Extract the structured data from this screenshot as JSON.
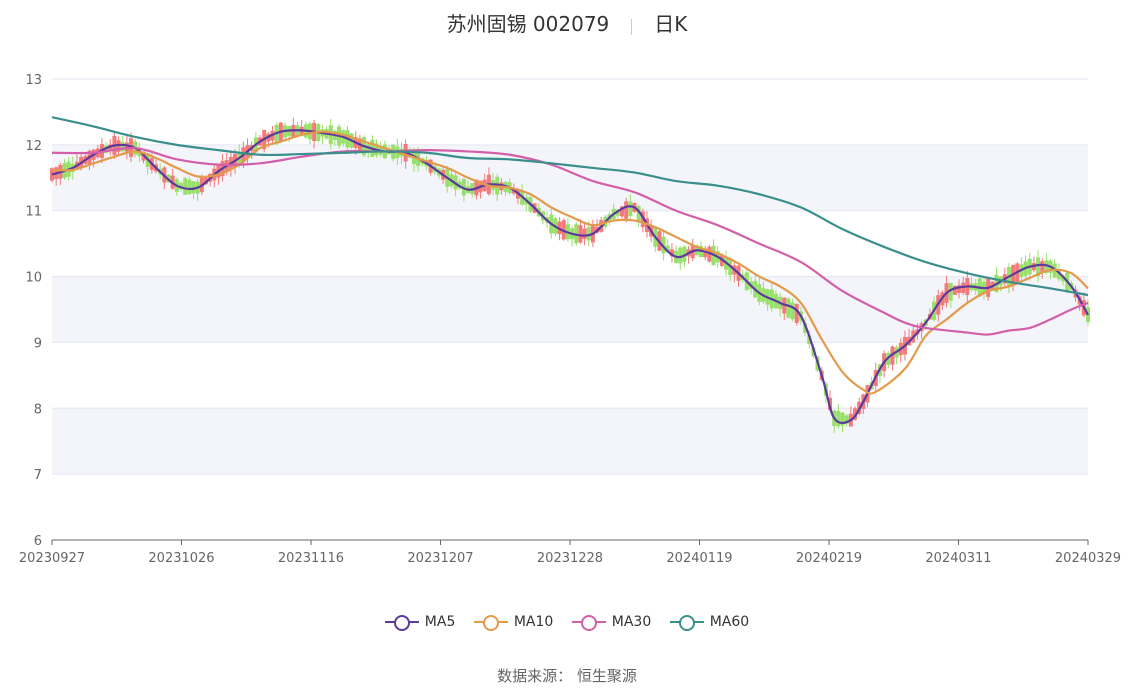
{
  "title": "苏州固锡 002079",
  "period": "日K",
  "source": "数据来源： 恒生聚源",
  "chart_data": {
    "type": "candlestick",
    "x_ticks": [
      "20230927",
      "20231026",
      "20231116",
      "20231207",
      "20231228",
      "20240119",
      "20240219",
      "20240311",
      "20240329"
    ],
    "ylim": [
      6,
      13
    ],
    "y_ticks": [
      "6",
      "7",
      "8",
      "9",
      "10",
      "11",
      "12",
      "13"
    ],
    "colors": {
      "up": "#f27a7a",
      "down": "#99e06b",
      "MA5": "#5a3a9c",
      "MA10": "#e39a4b",
      "MA30": "#d35fa8",
      "MA60": "#3a8f8c",
      "band": "#f4f5fb",
      "grid": "#e3e6f0"
    },
    "series": [
      {
        "name": "MA5",
        "points": [
          [
            0,
            11.55
          ],
          [
            5,
            11.65
          ],
          [
            10,
            11.85
          ],
          [
            15,
            11.99
          ],
          [
            20,
            11.95
          ],
          [
            25,
            11.65
          ],
          [
            30,
            11.38
          ],
          [
            35,
            11.35
          ],
          [
            40,
            11.6
          ],
          [
            45,
            11.8
          ],
          [
            50,
            12.05
          ],
          [
            55,
            12.2
          ],
          [
            60,
            12.22
          ],
          [
            65,
            12.18
          ],
          [
            70,
            12.12
          ],
          [
            75,
            11.98
          ],
          [
            80,
            11.9
          ],
          [
            85,
            11.88
          ],
          [
            90,
            11.72
          ],
          [
            95,
            11.5
          ],
          [
            100,
            11.32
          ],
          [
            105,
            11.4
          ],
          [
            110,
            11.35
          ],
          [
            115,
            11.1
          ],
          [
            120,
            10.8
          ],
          [
            125,
            10.65
          ],
          [
            130,
            10.65
          ],
          [
            135,
            10.95
          ],
          [
            140,
            11.05
          ],
          [
            145,
            10.6
          ],
          [
            150,
            10.3
          ],
          [
            155,
            10.4
          ],
          [
            160,
            10.3
          ],
          [
            165,
            10.05
          ],
          [
            170,
            9.75
          ],
          [
            175,
            9.6
          ],
          [
            180,
            9.4
          ],
          [
            185,
            8.5
          ],
          [
            188,
            7.85
          ],
          [
            192,
            7.82
          ],
          [
            195,
            8.1
          ],
          [
            200,
            8.7
          ],
          [
            205,
            8.95
          ],
          [
            210,
            9.3
          ],
          [
            215,
            9.75
          ],
          [
            220,
            9.85
          ],
          [
            225,
            9.83
          ],
          [
            230,
            10.0
          ],
          [
            235,
            10.15
          ],
          [
            240,
            10.15
          ],
          [
            245,
            9.85
          ],
          [
            249,
            9.42
          ]
        ]
      },
      {
        "name": "MA10",
        "points": [
          [
            0,
            11.62
          ],
          [
            5,
            11.62
          ],
          [
            10,
            11.72
          ],
          [
            15,
            11.82
          ],
          [
            20,
            11.9
          ],
          [
            25,
            11.8
          ],
          [
            30,
            11.65
          ],
          [
            35,
            11.52
          ],
          [
            40,
            11.55
          ],
          [
            45,
            11.7
          ],
          [
            50,
            11.95
          ],
          [
            55,
            12.05
          ],
          [
            60,
            12.15
          ],
          [
            65,
            12.2
          ],
          [
            70,
            12.15
          ],
          [
            75,
            12.05
          ],
          [
            80,
            11.95
          ],
          [
            85,
            11.85
          ],
          [
            90,
            11.75
          ],
          [
            95,
            11.65
          ],
          [
            100,
            11.5
          ],
          [
            105,
            11.38
          ],
          [
            110,
            11.35
          ],
          [
            115,
            11.25
          ],
          [
            120,
            11.05
          ],
          [
            125,
            10.9
          ],
          [
            130,
            10.78
          ],
          [
            135,
            10.85
          ],
          [
            140,
            10.85
          ],
          [
            145,
            10.75
          ],
          [
            150,
            10.6
          ],
          [
            155,
            10.45
          ],
          [
            160,
            10.35
          ],
          [
            165,
            10.2
          ],
          [
            170,
            10.0
          ],
          [
            175,
            9.85
          ],
          [
            180,
            9.6
          ],
          [
            185,
            9.05
          ],
          [
            190,
            8.55
          ],
          [
            195,
            8.28
          ],
          [
            198,
            8.25
          ],
          [
            205,
            8.6
          ],
          [
            210,
            9.1
          ],
          [
            215,
            9.35
          ],
          [
            220,
            9.6
          ],
          [
            225,
            9.78
          ],
          [
            230,
            9.85
          ],
          [
            235,
            9.98
          ],
          [
            240,
            10.1
          ],
          [
            245,
            10.05
          ],
          [
            249,
            9.82
          ]
        ]
      },
      {
        "name": "MA30",
        "points": [
          [
            0,
            11.88
          ],
          [
            10,
            11.88
          ],
          [
            20,
            11.95
          ],
          [
            30,
            11.78
          ],
          [
            40,
            11.7
          ],
          [
            50,
            11.72
          ],
          [
            60,
            11.82
          ],
          [
            70,
            11.9
          ],
          [
            80,
            11.9
          ],
          [
            90,
            11.92
          ],
          [
            100,
            11.9
          ],
          [
            110,
            11.85
          ],
          [
            120,
            11.7
          ],
          [
            130,
            11.45
          ],
          [
            140,
            11.28
          ],
          [
            150,
            11.0
          ],
          [
            160,
            10.78
          ],
          [
            170,
            10.5
          ],
          [
            180,
            10.22
          ],
          [
            190,
            9.78
          ],
          [
            200,
            9.45
          ],
          [
            205,
            9.3
          ],
          [
            210,
            9.22
          ],
          [
            220,
            9.15
          ],
          [
            225,
            9.12
          ],
          [
            230,
            9.18
          ],
          [
            235,
            9.22
          ],
          [
            240,
            9.35
          ],
          [
            245,
            9.5
          ],
          [
            249,
            9.6
          ]
        ]
      },
      {
        "name": "MA60",
        "points": [
          [
            0,
            12.42
          ],
          [
            10,
            12.28
          ],
          [
            20,
            12.12
          ],
          [
            30,
            12.0
          ],
          [
            40,
            11.92
          ],
          [
            50,
            11.85
          ],
          [
            60,
            11.86
          ],
          [
            70,
            11.88
          ],
          [
            80,
            11.9
          ],
          [
            90,
            11.88
          ],
          [
            100,
            11.8
          ],
          [
            110,
            11.78
          ],
          [
            120,
            11.72
          ],
          [
            130,
            11.65
          ],
          [
            140,
            11.58
          ],
          [
            150,
            11.45
          ],
          [
            160,
            11.38
          ],
          [
            170,
            11.25
          ],
          [
            180,
            11.05
          ],
          [
            190,
            10.72
          ],
          [
            200,
            10.45
          ],
          [
            210,
            10.22
          ],
          [
            220,
            10.05
          ],
          [
            230,
            9.92
          ],
          [
            240,
            9.82
          ],
          [
            249,
            9.72
          ]
        ]
      }
    ]
  }
}
